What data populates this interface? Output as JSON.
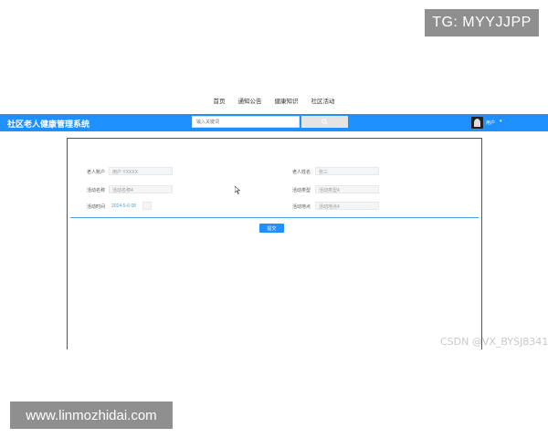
{
  "overlay": {
    "tg_label": "TG: MYYJJPP",
    "csdn_watermark": "CSDN @VX_BYSJ8341",
    "url_label": "www.linmozhidai.com"
  },
  "nav": {
    "items": [
      "首页",
      "通知公告",
      "健康知识",
      "社区活动"
    ]
  },
  "header": {
    "title": "社区老人健康管理系统",
    "search_placeholder": "输入关键词",
    "user_label": "用户",
    "caret": "▾"
  },
  "form": {
    "elder_account_label": "老人账户",
    "elder_account_value": "用户 YXXXX",
    "elder_name_label": "老人姓名",
    "elder_name_value": "张三",
    "activity_name_label": "活动名称",
    "activity_name_value": "活动名称4",
    "activity_type_label": "活动类型",
    "activity_type_value": "活动类型4",
    "activity_time_label": "活动时间",
    "activity_time_value": "2024-5-6 08",
    "activity_place_label": "活动地点",
    "activity_place_value": "活动地点4",
    "submit_label": "提交"
  },
  "colors": {
    "accent": "#1e90ff",
    "divider": "#4aa0e8"
  }
}
